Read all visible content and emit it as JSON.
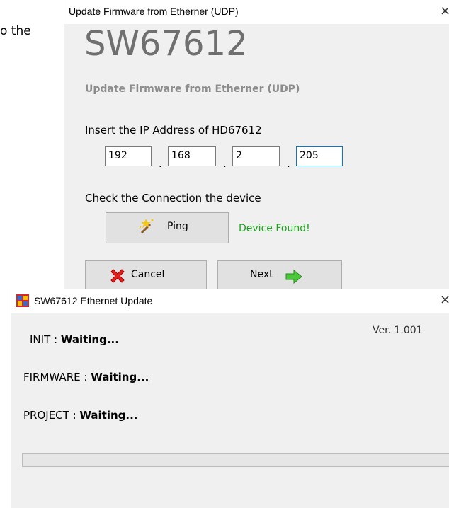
{
  "background": {
    "text": "o the"
  },
  "firmware_dialog": {
    "title": "Update Firmware from Etherner (UDP)",
    "close_glyph": "×",
    "product": "SW67612",
    "subtitle": "Update Firmware from Etherner (UDP)",
    "ip_prompt": "Insert the IP Address of HD67612",
    "ip": [
      "192",
      "168",
      "2",
      "205"
    ],
    "ip_separator": ".",
    "check_prompt": "Check the Connection the device",
    "ping_label": "Ping",
    "ping_icon": "magic-wand-icon",
    "status": "Device Found!",
    "status_color": "#19a319",
    "cancel_label": "Cancel",
    "cancel_icon": "red-x-icon",
    "next_label": "Next",
    "next_icon": "green-arrow-right-icon"
  },
  "update_dialog": {
    "title": "SW67612 Ethernet Update",
    "close_glyph": "×",
    "app_icon": "app-icon",
    "version": "Ver. 1.001",
    "init_label": "INIT : ",
    "init_value": "Waiting...",
    "firmware_label": "FIRMWARE : ",
    "firmware_value": "Waiting...",
    "project_label": "PROJECT : ",
    "project_value": "Waiting...",
    "progress": 0
  }
}
